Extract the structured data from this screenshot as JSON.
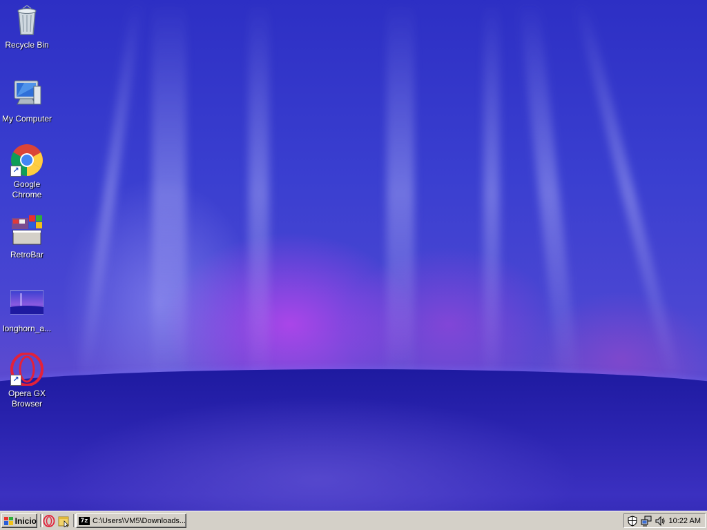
{
  "desktop": {
    "icons": [
      {
        "label": "Recycle Bin"
      },
      {
        "label": "My Computer"
      },
      {
        "label": "Google Chrome"
      },
      {
        "label": "RetroBar"
      },
      {
        "label": "longhorn_a..."
      },
      {
        "label": "Opera GX Browser"
      }
    ]
  },
  "taskbar": {
    "start_label": "Inicio",
    "task_button_label": "C:\\Users\\VM5\\Downloads...",
    "task_button_badge": "7z",
    "clock": "10:22 AM"
  },
  "colors": {
    "taskbar": "#d4d0c8",
    "wallpaper_base": "#3a3fd0",
    "opera_red": "#e3213a"
  }
}
